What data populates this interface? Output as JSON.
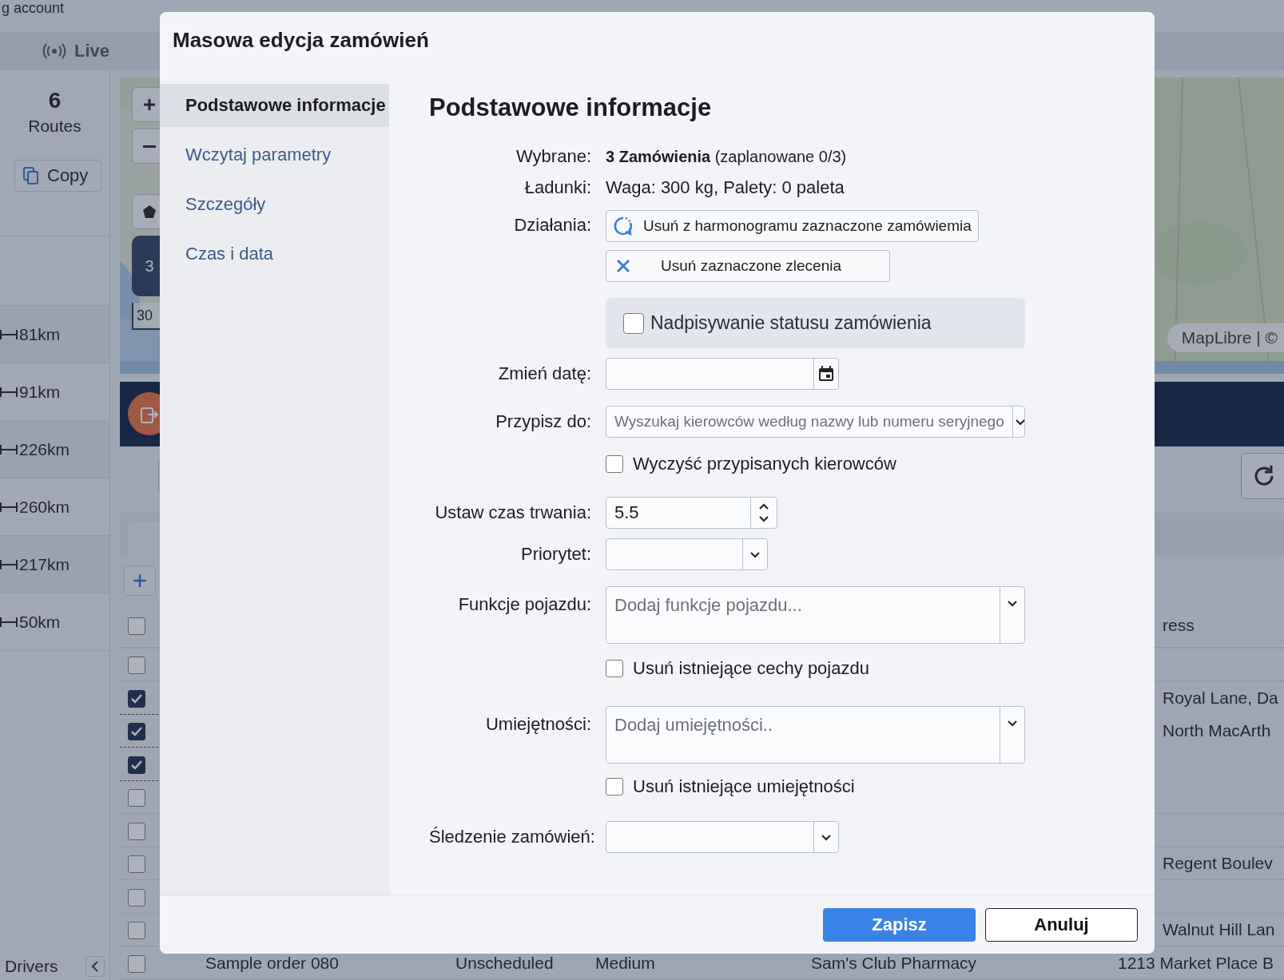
{
  "app": {
    "account_text": "g account",
    "live": "Live",
    "routes": {
      "count": "6",
      "label": "Routes"
    },
    "copy": "Copy",
    "route_distances": [
      "81km",
      "91km",
      "226km",
      "260km",
      "217km",
      "50km"
    ],
    "drivers": "Drivers",
    "map": {
      "badge": "3",
      "scale": "30",
      "attribution": "MapLibre | ©"
    },
    "orders": {
      "header_address": "ress",
      "header_checked": false,
      "rows": [
        {
          "checked": false
        },
        {
          "checked": true,
          "address": "Royal Lane, Da"
        },
        {
          "checked": true,
          "address": "North MacArth"
        },
        {
          "checked": true
        },
        {
          "checked": false
        },
        {
          "checked": false
        },
        {
          "checked": false,
          "address": "Regent Boulev"
        },
        {
          "checked": false
        },
        {
          "checked": false,
          "address": "Walnut Hill Lan"
        },
        {
          "checked": false,
          "name": "Sample order 080",
          "status": "Unscheduled",
          "priority": "Medium",
          "customer": "Sam's Club Pharmacy",
          "address": "1213 Market Place B"
        }
      ]
    }
  },
  "dialog": {
    "title": "Masowa edycja zamówień",
    "nav": [
      {
        "label": "Podstawowe informacje",
        "selected": true
      },
      {
        "label": "Wczytaj parametry",
        "selected": false
      },
      {
        "label": "Szczegóły",
        "selected": false
      },
      {
        "label": "Czas i data",
        "selected": false
      }
    ],
    "heading": "Podstawowe informacje",
    "fields": [
      {
        "kind": "info",
        "label": "Wybrane:",
        "value": "**3 Zamówienia** (zaplanowane 0/3)"
      },
      {
        "kind": "info",
        "label": "Ładunki:",
        "value": "Waga: 300 kg, Palety: 0 paleta"
      },
      {
        "kind": "actions",
        "label": "Działania:",
        "buttons": [
          {
            "label": "Usuń z harmonogramu zaznaczone zamówiemia"
          },
          {
            "label": "Usuń zaznaczone zlecenia"
          }
        ]
      },
      {
        "kind": "panel-checkbox",
        "label": "Nadpisywanie statusu zamówienia",
        "checked": false
      },
      {
        "kind": "date",
        "label": "Zmień datę:"
      },
      {
        "kind": "select",
        "label": "Przypisz do:",
        "placeholder": "Wyszukaj kierowców według nazwy lub numeru seryjnego"
      },
      {
        "kind": "checkbox",
        "label": "Wyczyść przypisanych kierowców",
        "checked": false
      },
      {
        "kind": "number",
        "label": "Ustaw czas trwania:",
        "value": "5.5"
      },
      {
        "kind": "select",
        "label": "Priorytet:"
      },
      {
        "kind": "multiselect",
        "label": "Funkcje pojazdu:",
        "placeholder": "Dodaj funkcje pojazdu..."
      },
      {
        "kind": "checkbox",
        "label": "Usuń istniejące cechy pojazdu",
        "checked": false
      },
      {
        "kind": "multiselect",
        "label": "Umiejętności:",
        "placeholder": "Dodaj umiejętności.."
      },
      {
        "kind": "checkbox",
        "label": "Usuń istniejące umiejętności",
        "checked": false
      },
      {
        "kind": "select",
        "label": "Śledzenie zamówień:"
      }
    ],
    "buttons": [
      {
        "kind": "primary",
        "label": "Zapisz"
      },
      {
        "kind": "secondary",
        "label": "Anuluj"
      }
    ]
  }
}
